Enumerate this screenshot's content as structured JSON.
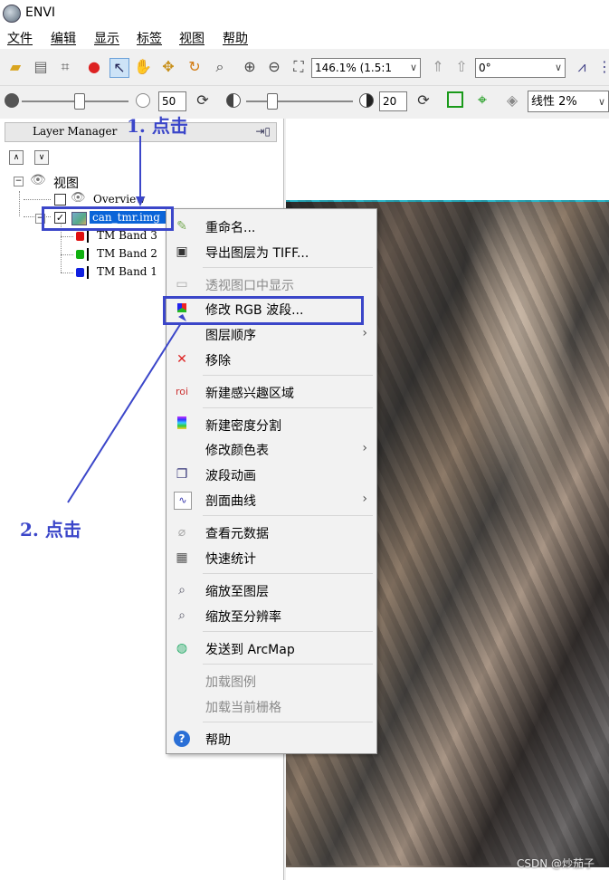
{
  "window": {
    "title": "ENVI",
    "app_icon": "envi-globe-icon"
  },
  "menubar": {
    "items": [
      "文件",
      "编辑",
      "显示",
      "标签",
      "视图",
      "帮助"
    ]
  },
  "toolbar": {
    "zoom_value": "146.1% (1.5:1",
    "rotation_value": "0°",
    "brightness_value": "50",
    "contrast_value": "20",
    "stretch_value": "线性 2%"
  },
  "layer_manager": {
    "title": "Layer Manager",
    "tree": {
      "root": "视图",
      "overview": "Overview",
      "image_layer": "can_tmr.img",
      "bands": [
        {
          "label": "TM Band 3",
          "color": "#e01010"
        },
        {
          "label": "TM Band 2",
          "color": "#10b010"
        },
        {
          "label": "TM Band 1",
          "color": "#1020e0"
        }
      ]
    }
  },
  "context_menu": {
    "items": [
      {
        "label": "重命名...",
        "icon": "rename-icon",
        "enabled": true,
        "submenu": false
      },
      {
        "label": "导出图层为 TIFF...",
        "icon": "save-icon",
        "enabled": true,
        "submenu": false
      },
      {
        "label": "透视图口中显示",
        "icon": "window-icon",
        "enabled": false,
        "submenu": false
      },
      {
        "label": "修改 RGB 波段...",
        "icon": "rgb-icon",
        "enabled": true,
        "submenu": false
      },
      {
        "label": "图层顺序",
        "icon": "",
        "enabled": true,
        "submenu": true
      },
      {
        "label": "移除",
        "icon": "remove-x-icon",
        "enabled": true,
        "submenu": false
      },
      {
        "label": "新建感兴趣区域",
        "icon": "roi-icon",
        "enabled": true,
        "submenu": false
      },
      {
        "label": "新建密度分割",
        "icon": "density-slice-icon",
        "enabled": true,
        "submenu": false
      },
      {
        "label": "修改颜色表",
        "icon": "",
        "enabled": true,
        "submenu": true
      },
      {
        "label": "波段动画",
        "icon": "animation-icon",
        "enabled": true,
        "submenu": false
      },
      {
        "label": "剖面曲线",
        "icon": "profile-icon",
        "enabled": true,
        "submenu": true
      },
      {
        "label": "查看元数据",
        "icon": "metadata-icon",
        "enabled": true,
        "submenu": false
      },
      {
        "label": "快速统计",
        "icon": "statistics-icon",
        "enabled": true,
        "submenu": false
      },
      {
        "label": "缩放至图层",
        "icon": "zoom-to-layer-icon",
        "enabled": true,
        "submenu": false
      },
      {
        "label": "缩放至分辨率",
        "icon": "zoom-resolution-icon",
        "enabled": true,
        "submenu": false
      },
      {
        "label": "发送到 ArcMap",
        "icon": "arcmap-icon",
        "enabled": true,
        "submenu": false
      },
      {
        "label": "加载图例",
        "icon": "",
        "enabled": false,
        "submenu": false
      },
      {
        "label": "加载当前栅格",
        "icon": "",
        "enabled": false,
        "submenu": false
      },
      {
        "label": "帮助",
        "icon": "help-icon",
        "enabled": true,
        "submenu": false
      }
    ]
  },
  "annotations": {
    "step1": "1. 点击",
    "step2": "2. 点击",
    "color": "#3b46c9"
  },
  "watermark": "CSDN @炒茄子"
}
